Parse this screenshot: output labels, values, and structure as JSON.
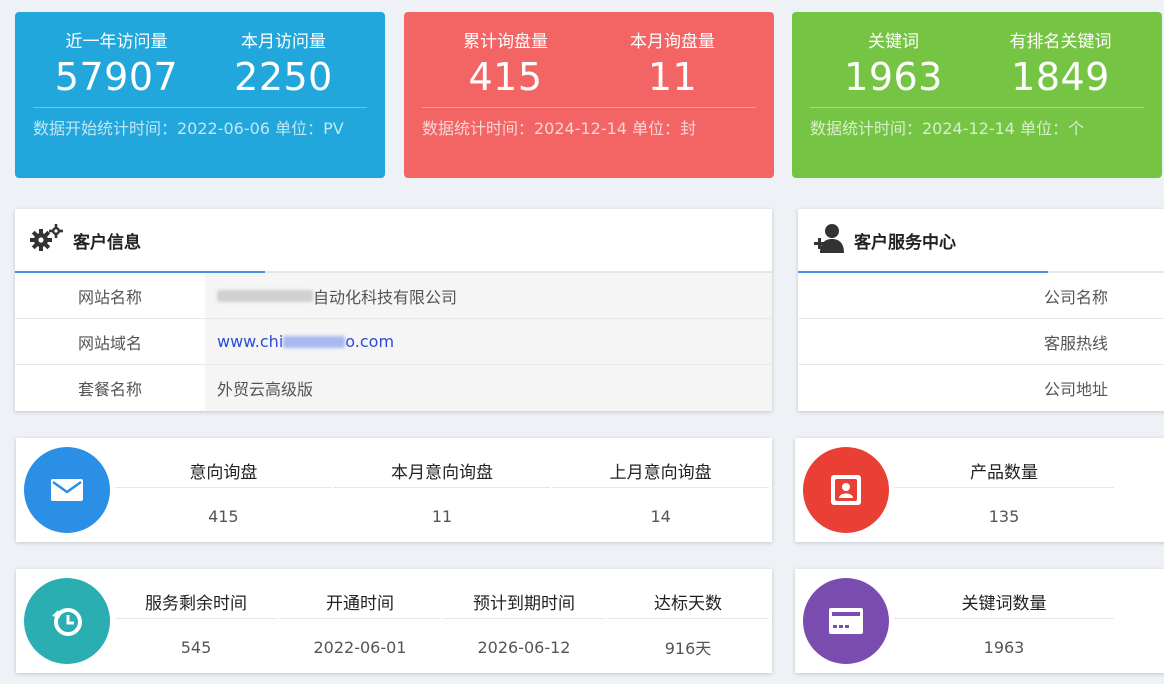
{
  "stats": [
    {
      "items": [
        {
          "label": "近一年访问量",
          "value": "57907"
        },
        {
          "label": "本月访问量",
          "value": "2250"
        }
      ],
      "note": "数据开始统计时间：2022-06-06    单位：PV",
      "color": "#22a7dc"
    },
    {
      "items": [
        {
          "label": "累计询盘量",
          "value": "415"
        },
        {
          "label": "本月询盘量",
          "value": "11"
        }
      ],
      "note": "数据统计时间：2024-12-14    单位：封",
      "color": "#f36464"
    },
    {
      "items": [
        {
          "label": "关键词",
          "value": "1963"
        },
        {
          "label": "有排名关键词",
          "value": "1849"
        }
      ],
      "note": "数据统计时间：2024-12-14    单位：个",
      "color": "#76c444"
    }
  ],
  "customer_info": {
    "title": "客户信息",
    "rows": [
      {
        "key": "网站名称",
        "value": "自动化科技有限公司"
      },
      {
        "key": "网站域名",
        "value_prefix": "www.chi",
        "value_suffix": "o.com"
      },
      {
        "key": "套餐名称",
        "value": "外贸云高级版"
      }
    ]
  },
  "service_center": {
    "title": "客户服务中心",
    "rows": [
      {
        "key": "公司名称"
      },
      {
        "key": "客服热线"
      },
      {
        "key": "公司地址"
      }
    ]
  },
  "inquiry_metrics": {
    "icon": "envelope-icon",
    "color": "#2b8fe6",
    "cols": [
      {
        "label": "意向询盘",
        "value": "415"
      },
      {
        "label": "本月意向询盘",
        "value": "11"
      },
      {
        "label": "上月意向询盘",
        "value": "14"
      }
    ]
  },
  "product_metrics": {
    "icon": "contact-card-icon",
    "color": "#ea3f34",
    "cols": [
      {
        "label": "产品数量",
        "value": "135"
      }
    ]
  },
  "service_metrics": {
    "icon": "history-clock-icon",
    "color": "#2aaeb2",
    "cols": [
      {
        "label": "服务剩余时间",
        "value": "545"
      },
      {
        "label": "开通时间",
        "value": "2022-06-01"
      },
      {
        "label": "预计到期时间",
        "value": "2026-06-12"
      },
      {
        "label": "达标天数",
        "value": "916天"
      }
    ]
  },
  "keyword_metrics": {
    "icon": "credit-card-icon",
    "color": "#7a4cb0",
    "cols": [
      {
        "label": "关键词数量",
        "value": "1963"
      }
    ]
  }
}
